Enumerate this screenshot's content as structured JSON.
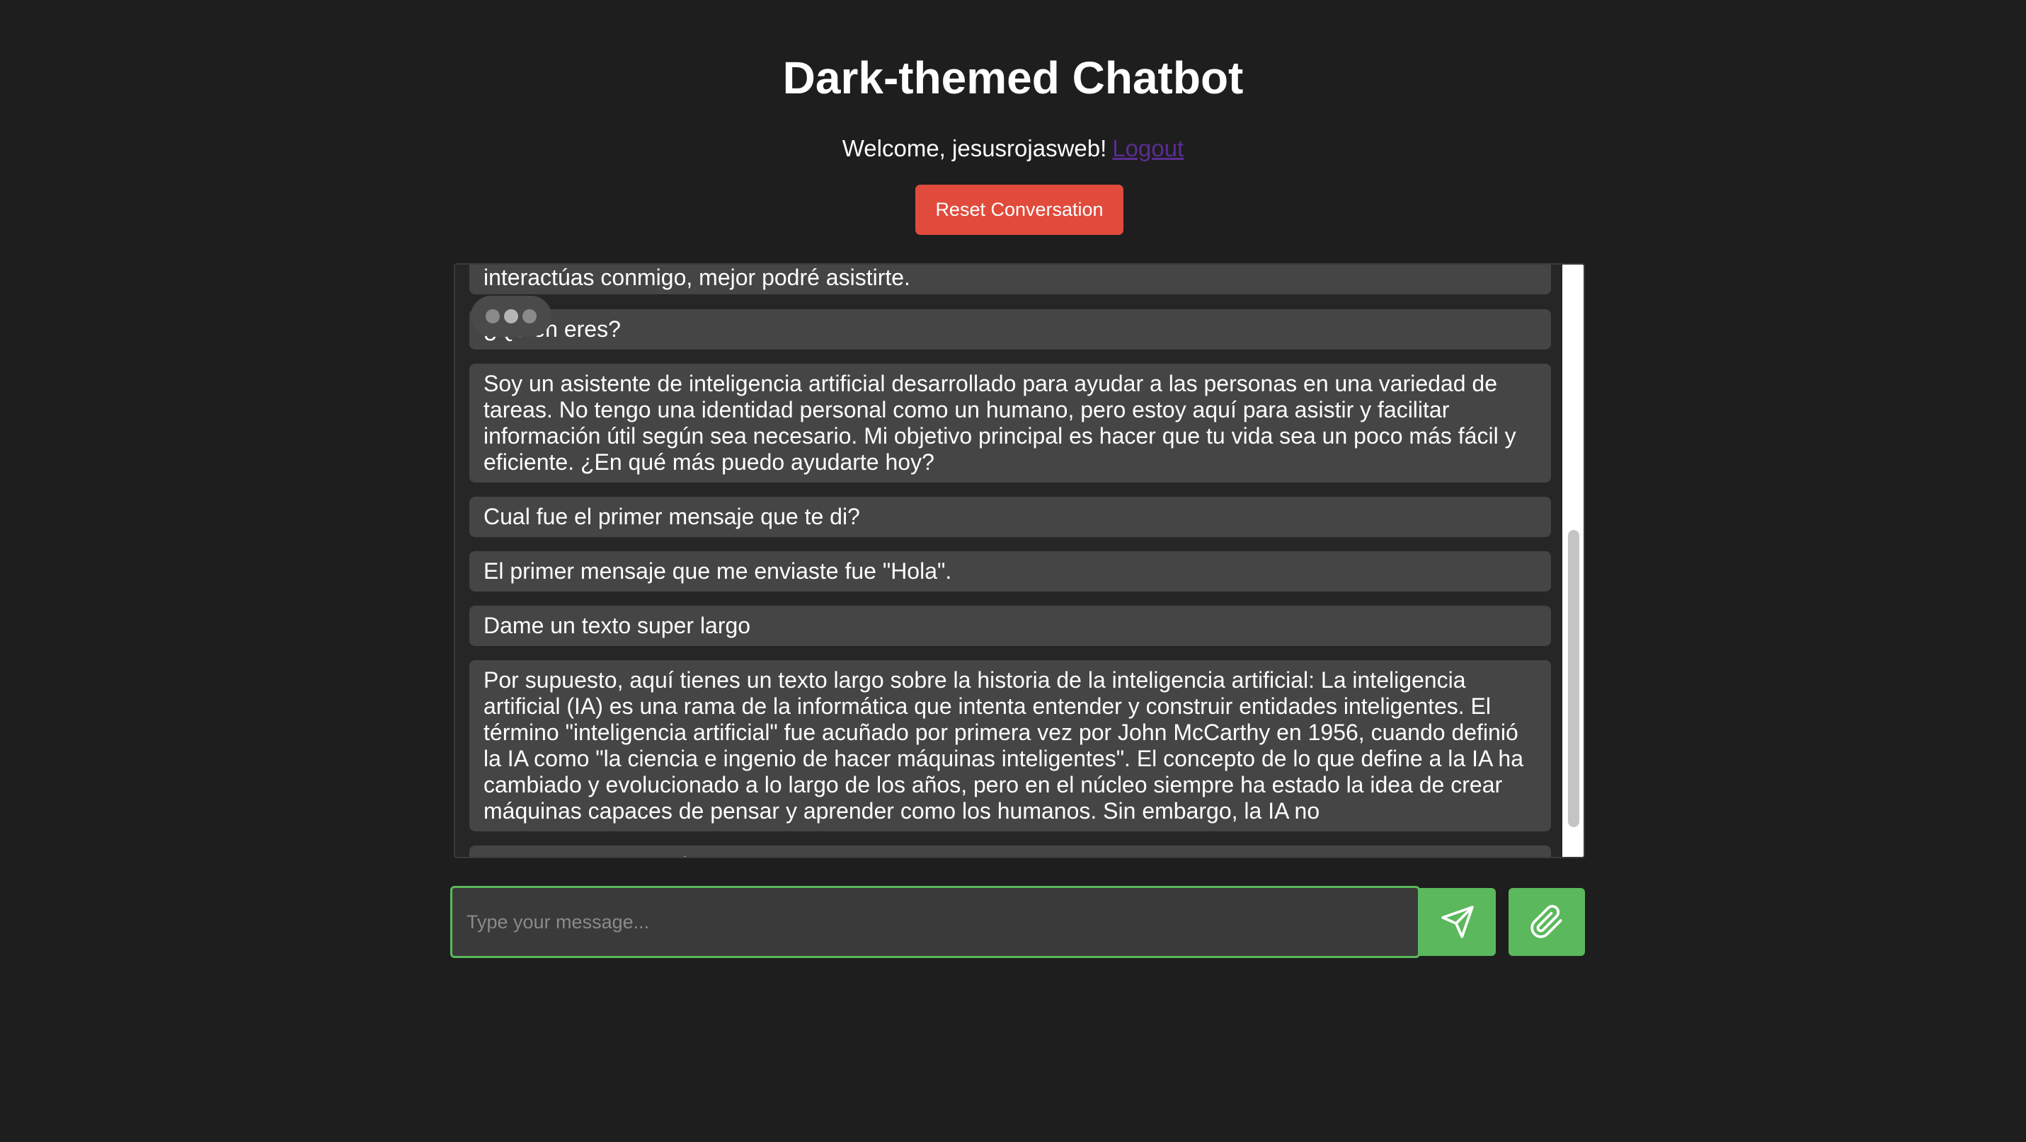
{
  "header": {
    "title": "Dark-themed Chatbot",
    "welcome_text": "Welcome, jesusrojasweb!",
    "logout_label": "Logout"
  },
  "actions": {
    "reset_label": "Reset Conversation"
  },
  "messages": [
    {
      "role": "bot",
      "text": "interactúas conmigo, mejor podré asistirte."
    },
    {
      "role": "user",
      "text": "¿Quién eres?"
    },
    {
      "role": "bot",
      "text": "Soy un asistente de inteligencia artificial desarrollado para ayudar a las personas en una variedad de tareas. No tengo una identidad personal como un humano, pero estoy aquí para asistir y facilitar información útil según sea necesario. Mi objetivo principal es hacer que tu vida sea un poco más fácil y eficiente. ¿En qué más puedo ayudarte hoy?"
    },
    {
      "role": "user",
      "text": "Cual fue el primer mensaje que te di?"
    },
    {
      "role": "bot",
      "text": "El primer mensaje que me enviaste fue \"Hola\"."
    },
    {
      "role": "user",
      "text": "Dame un texto super largo"
    },
    {
      "role": "bot",
      "text": "Por supuesto, aquí tienes un texto largo sobre la historia de la inteligencia artificial: La inteligencia artificial (IA) es una rama de la informática que intenta entender y construir entidades inteligentes. El término \"inteligencia artificial\" fue acuñado por primera vez por John McCarthy en 1956, cuando definió la IA como \"la ciencia e ingenio de hacer máquinas inteligentes\". El concepto de lo que define a la IA ha cambiado y evolucionado a lo largo de los años, pero en el núcleo siempre ha estado la idea de crear máquinas capaces de pensar y aprender como los humanos. Sin embargo, la IA no"
    },
    {
      "role": "user",
      "text": "Otro texto aun mas largo"
    }
  ],
  "composer": {
    "placeholder": "Type your message...",
    "value": ""
  },
  "icons": {
    "send": "send-icon",
    "attach": "paperclip-icon",
    "typing": "typing-indicator-icon"
  },
  "colors": {
    "background": "#1e1e1e",
    "message_bg": "#454545",
    "accent_green": "#5cb85c",
    "reset_red": "#e04b3c",
    "logout_link": "#5a2d91"
  }
}
